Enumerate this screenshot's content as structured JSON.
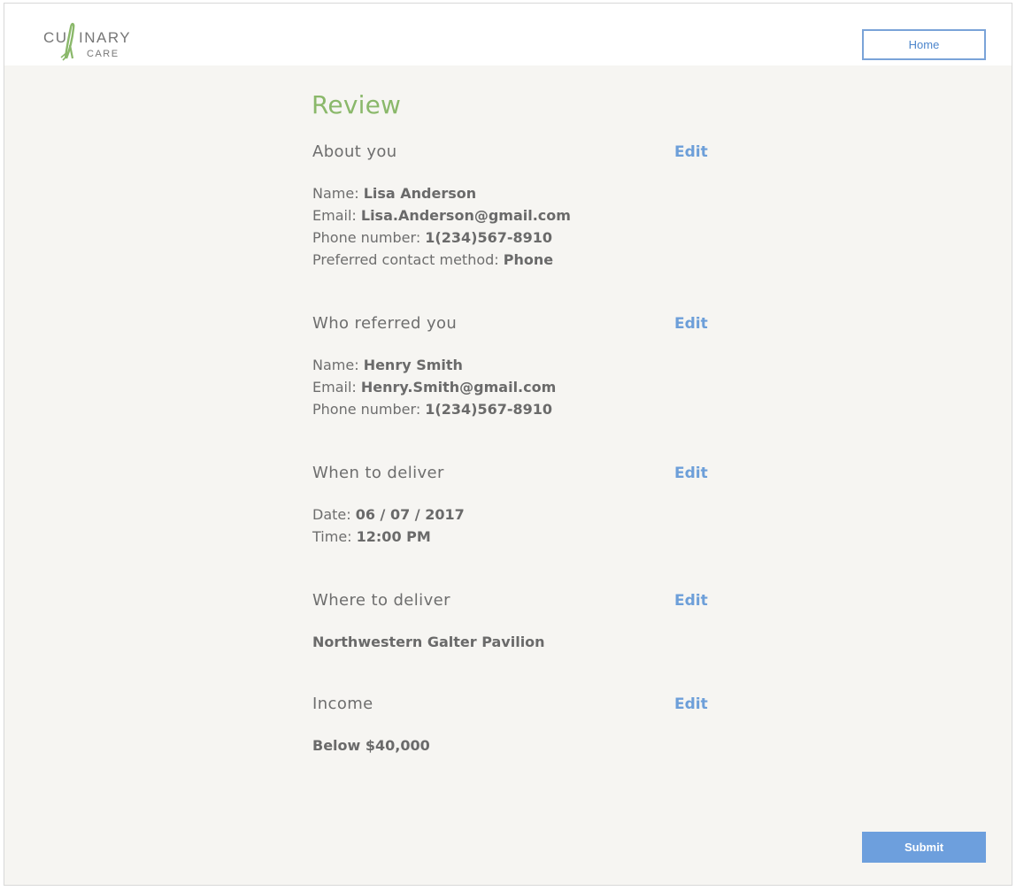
{
  "brand": {
    "logo_word_top": "CULINARY",
    "logo_word_bottom": "CARE",
    "logo_accent_color": "#8ab86a",
    "logo_text_color": "#777777"
  },
  "header": {
    "home_label": "Home"
  },
  "page": {
    "title": "Review"
  },
  "sections": {
    "about": {
      "title": "About you",
      "edit_label": "Edit",
      "rows": [
        {
          "label": "Name: ",
          "value": "Lisa Anderson"
        },
        {
          "label": "Email: ",
          "value": "Lisa.Anderson@gmail.com"
        },
        {
          "label": "Phone number: ",
          "value": "1(234)567-8910"
        },
        {
          "label": "Preferred contact method: ",
          "value": "Phone"
        }
      ]
    },
    "referrer": {
      "title": "Who referred you",
      "edit_label": "Edit",
      "rows": [
        {
          "label": "Name: ",
          "value": "Henry Smith"
        },
        {
          "label": "Email: ",
          "value": "Henry.Smith@gmail.com"
        },
        {
          "label": "Phone number: ",
          "value": "1(234)567-8910"
        }
      ]
    },
    "when": {
      "title": "When to deliver",
      "edit_label": "Edit",
      "rows": [
        {
          "label": "Date: ",
          "value": "06 / 07 / 2017"
        },
        {
          "label": "Time: ",
          "value": "12:00 PM"
        }
      ]
    },
    "where": {
      "title": "Where to deliver",
      "edit_label": "Edit",
      "value": "Northwestern Galter Pavilion"
    },
    "income": {
      "title": "Income",
      "edit_label": "Edit",
      "value": "Below $40,000"
    }
  },
  "footer": {
    "submit_label": "Submit"
  },
  "colors": {
    "accent_blue": "#6d9fd9",
    "accent_green": "#8ab86a",
    "background": "#f6f5f2"
  }
}
